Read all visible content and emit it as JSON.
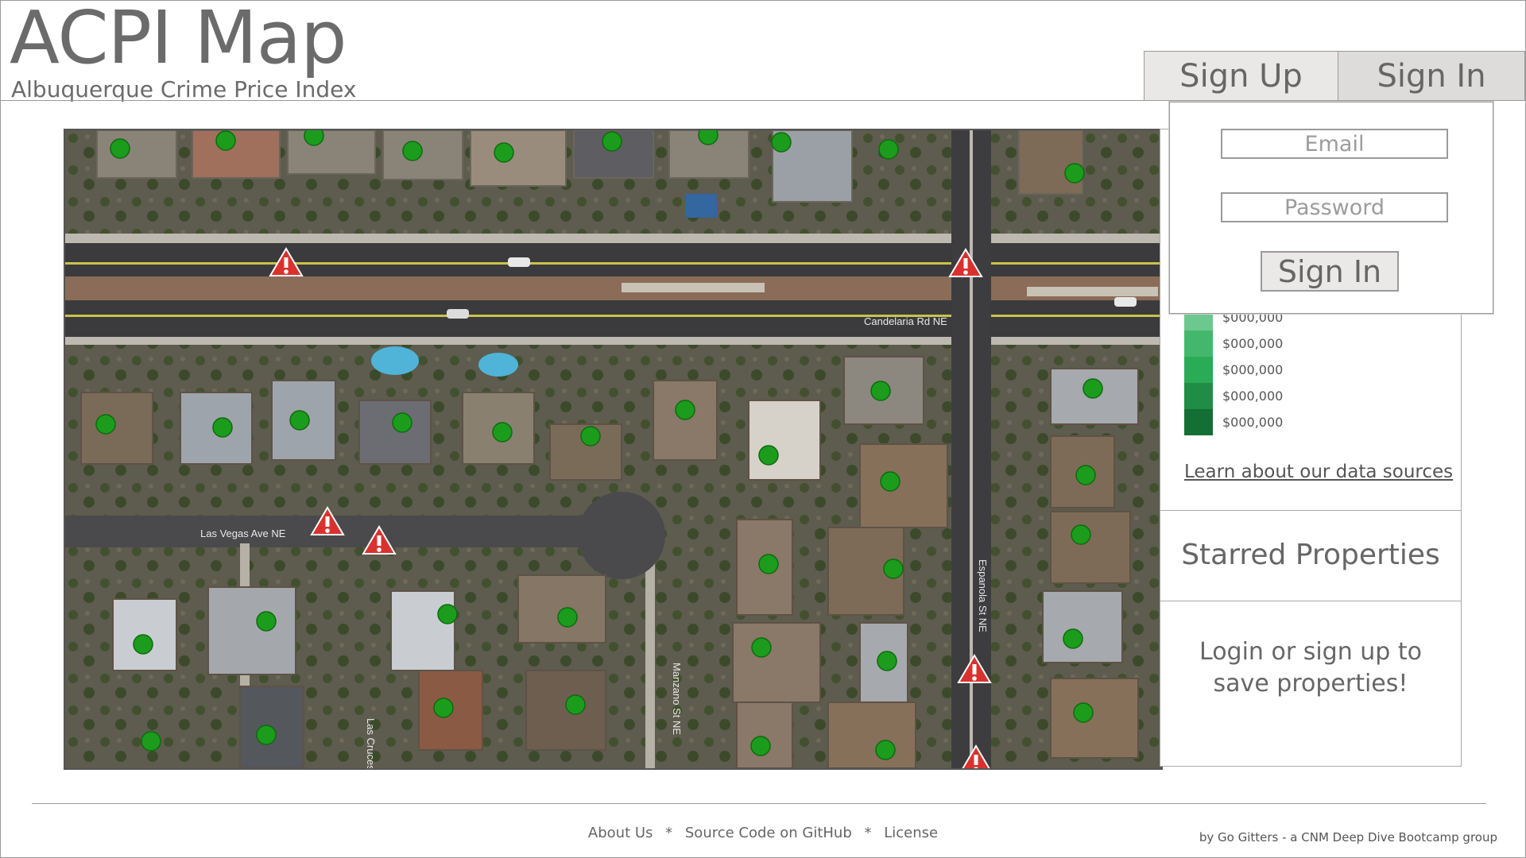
{
  "header": {
    "title": "ACPI Map",
    "subtitle": "Albuquerque Crime Price Index"
  },
  "auth": {
    "tabs": [
      "Sign Up",
      "Sign In"
    ],
    "email_placeholder": "Email",
    "password_placeholder": "Password",
    "submit_label": "Sign In"
  },
  "map": {
    "street_labels": [
      "Candelaria Rd NE",
      "Las Vegas Ave NE",
      "Las Cruces Ct",
      "Manzano St NE",
      "Espanola St NE"
    ],
    "marker_color": "#1c9c1c",
    "alert_color": "#d9322e"
  },
  "sidebar": {
    "legend": [
      {
        "label": "$000,000",
        "color": "#6cc88e"
      },
      {
        "label": "$000,000",
        "color": "#43b86c"
      },
      {
        "label": "$000,000",
        "color": "#2aab55"
      },
      {
        "label": "$000,000",
        "color": "#1f8d45"
      },
      {
        "label": "$000,000",
        "color": "#146f34"
      }
    ],
    "data_sources_link": "Learn about our data sources",
    "starred_heading": "Starred Properties",
    "login_message": "Login or sign up to save properties!"
  },
  "footer": {
    "links": [
      "About Us",
      "Source Code on GitHub",
      "License"
    ],
    "separator": "*",
    "credit": "by Go Gitters - a CNM Deep Dive Bootcamp group"
  }
}
